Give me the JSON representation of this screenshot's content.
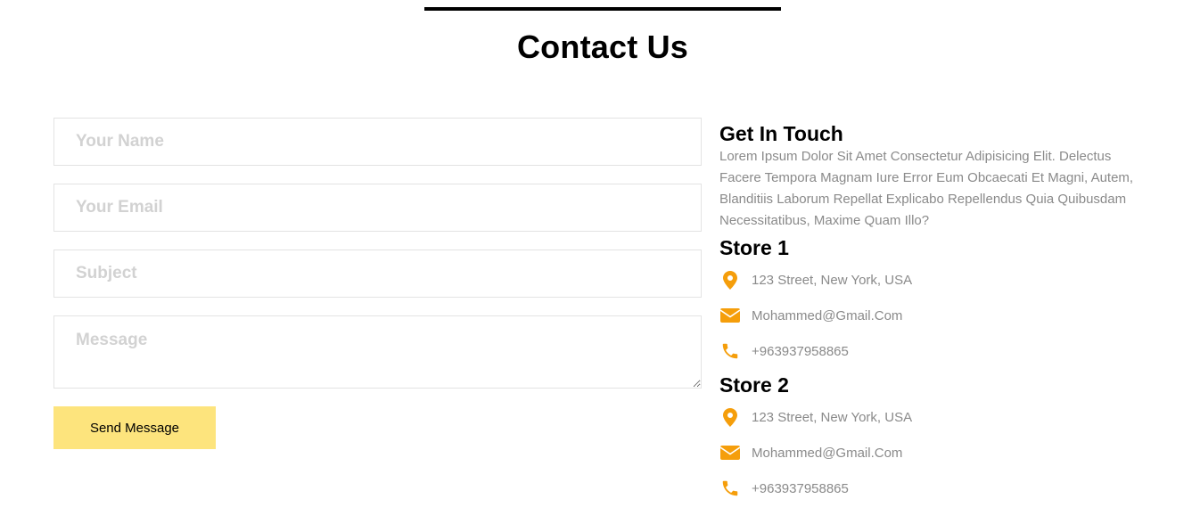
{
  "page": {
    "title": "Contact Us"
  },
  "form": {
    "name_placeholder": "Your Name",
    "email_placeholder": "Your Email",
    "subject_placeholder": "Subject",
    "message_placeholder": "Message",
    "send_label": "Send Message"
  },
  "info": {
    "heading": "Get In Touch",
    "description": "Lorem Ipsum Dolor Sit Amet Consectetur Adipisicing Elit. Delectus Facere Tempora Magnam Iure Error Eum Obcaecati Et Magni, Autem, Blanditiis Laborum Repellat Explicabo Repellendus Quia Quibusdam Necessitatibus, Maxime Quam Illo?"
  },
  "stores": [
    {
      "name": "Store 1",
      "address": "123 Street, New York, USA",
      "email": "Mohammed@Gmail.Com",
      "phone": "+963937958865"
    },
    {
      "name": "Store 2",
      "address": "123 Street, New York, USA",
      "email": "Mohammed@Gmail.Com",
      "phone": "+963937958865"
    }
  ],
  "icons": {
    "address": "map-pin-icon",
    "email": "envelope-icon",
    "phone": "phone-icon"
  },
  "colors": {
    "accent": "#f59e0b",
    "button": "#fde47d",
    "muted_text": "#8a8a8a"
  }
}
